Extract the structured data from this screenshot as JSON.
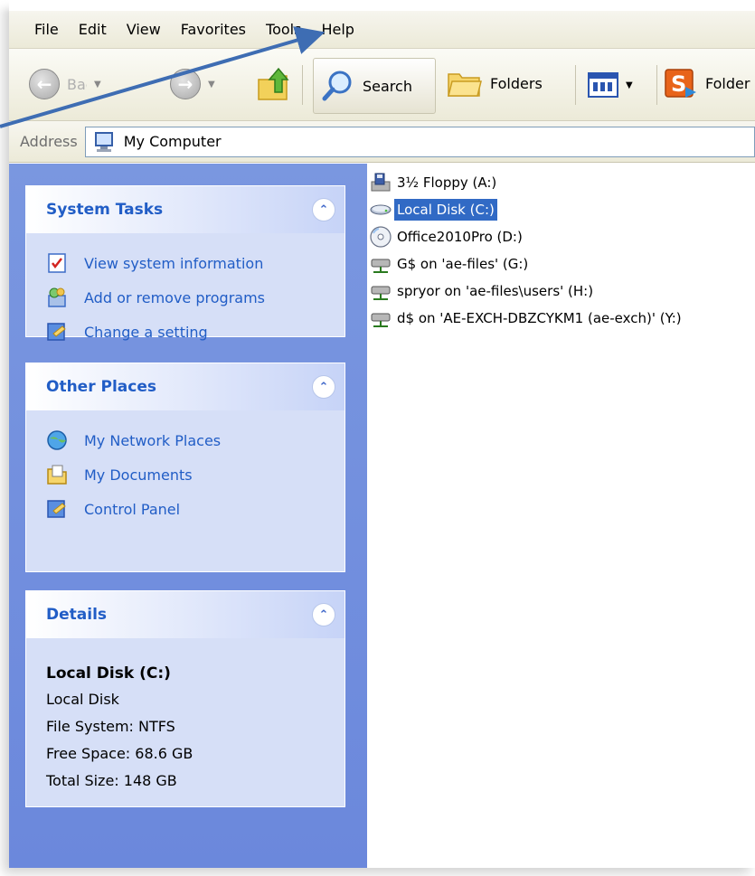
{
  "menu": [
    "File",
    "Edit",
    "View",
    "Favorites",
    "Tools",
    "Help"
  ],
  "toolbar": {
    "back_label": "Back",
    "search_label": "Search",
    "folders_label": "Folders",
    "folder_sync_label": "Folder"
  },
  "address": {
    "label": "Address",
    "value": "My Computer"
  },
  "system_tasks": {
    "title": "System Tasks",
    "items": [
      {
        "label": "View system information",
        "icon": "system-info-icon"
      },
      {
        "label": "Add or remove programs",
        "icon": "add-remove-programs-icon"
      },
      {
        "label": "Change a setting",
        "icon": "control-panel-icon"
      }
    ]
  },
  "other_places": {
    "title": "Other Places",
    "items": [
      {
        "label": "My Network Places",
        "icon": "network-places-icon"
      },
      {
        "label": "My Documents",
        "icon": "my-documents-icon"
      },
      {
        "label": "Control Panel",
        "icon": "control-panel-icon"
      }
    ]
  },
  "details": {
    "title": "Details",
    "name": "Local Disk (C:)",
    "type": "Local Disk",
    "file_system": "File System: NTFS",
    "free_space": "Free Space: 68.6 GB",
    "total_size": "Total Size: 148 GB"
  },
  "drives": [
    {
      "label": "3½ Floppy (A:)",
      "icon": "floppy-drive-icon",
      "selected": false
    },
    {
      "label": "Local Disk (C:)",
      "icon": "hard-disk-icon",
      "selected": true
    },
    {
      "label": "Office2010Pro (D:)",
      "icon": "cd-drive-icon",
      "selected": false
    },
    {
      "label": "G$ on 'ae-files' (G:)",
      "icon": "network-drive-icon",
      "selected": false
    },
    {
      "label": "spryor on 'ae-files\\users' (H:)",
      "icon": "network-drive-icon",
      "selected": false
    },
    {
      "label": "d$ on 'AE-EXCH-DBZCYKM1 (ae-exch)' (Y:)",
      "icon": "network-drive-icon",
      "selected": false
    }
  ],
  "colors": {
    "task_pane_blue": "#6b88dc",
    "link_blue": "#215dc6",
    "selection_blue": "#316ac5",
    "annotation_arrow": "#3e6db3"
  }
}
